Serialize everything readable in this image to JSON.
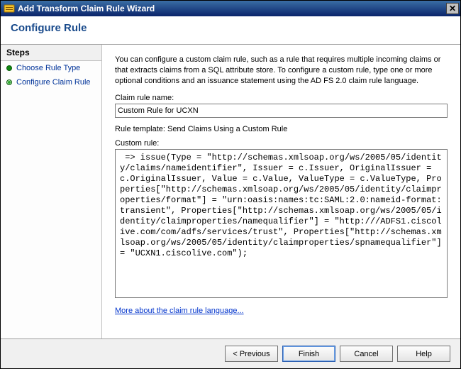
{
  "window": {
    "title": "Add Transform Claim Rule Wizard"
  },
  "header": {
    "heading": "Configure Rule"
  },
  "sidebar": {
    "steps_heading": "Steps",
    "items": [
      {
        "label": "Choose Rule Type"
      },
      {
        "label": "Configure Claim Rule"
      }
    ]
  },
  "main": {
    "intro_text": "You can configure a custom claim rule, such as a rule that requires multiple incoming claims or that extracts claims from a SQL attribute store. To configure a custom rule, type one or more optional conditions and an issuance statement using the AD FS 2.0 claim rule language.",
    "claim_rule_name_label": "Claim rule name:",
    "claim_rule_name_value": "Custom Rule for UCXN",
    "rule_template_label": "Rule template: Send Claims Using a Custom Rule",
    "custom_rule_label": "Custom rule:",
    "custom_rule_value": " => issue(Type = \"http://schemas.xmlsoap.org/ws/2005/05/identity/claims/nameidentifier\", Issuer = c.Issuer, OriginalIssuer = c.OriginalIssuer, Value = c.Value, ValueType = c.ValueType, Properties[\"http://schemas.xmlsoap.org/ws/2005/05/identity/claimproperties/format\"] = \"urn:oasis:names:tc:SAML:2.0:nameid-format:transient\", Properties[\"http://schemas.xmlsoap.org/ws/2005/05/identity/claimproperties/namequalifier\"] = \"http:///ADFS1.ciscolive.com/com/adfs/services/trust\", Properties[\"http://schemas.xmlsoap.org/ws/2005/05/identity/claimproperties/spnamequalifier\"] = \"UCXN1.ciscolive.com\");",
    "more_link": "More about the claim rule language..."
  },
  "footer": {
    "previous": "< Previous",
    "finish": "Finish",
    "cancel": "Cancel",
    "help": "Help"
  }
}
